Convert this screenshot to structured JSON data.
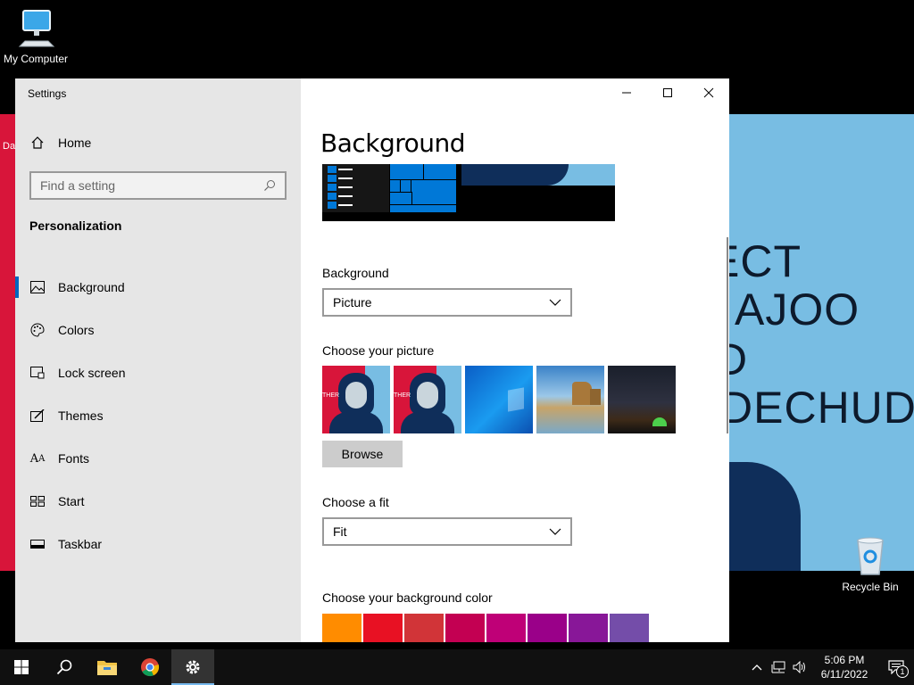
{
  "desktop": {
    "my_computer_label": "My Computer",
    "recycle_bin_label": "Recycle Bin",
    "left_strip_text": "Da",
    "wallpaper_text_lines": [
      "ECT",
      "AJOO",
      "D",
      "DECHUD"
    ]
  },
  "window": {
    "title": "Settings",
    "minimize_icon": "minimize-icon",
    "maximize_icon": "maximize-icon",
    "close_icon": "close-icon"
  },
  "sidebar": {
    "home_label": "Home",
    "search_placeholder": "Find a setting",
    "section_heading": "Personalization",
    "items": [
      {
        "label": "Background",
        "icon": "picture-icon",
        "active": true
      },
      {
        "label": "Colors",
        "icon": "palette-icon",
        "active": false
      },
      {
        "label": "Lock screen",
        "icon": "lock-screen-icon",
        "active": false
      },
      {
        "label": "Themes",
        "icon": "themes-icon",
        "active": false
      },
      {
        "label": "Fonts",
        "icon": "fonts-icon",
        "active": false
      },
      {
        "label": "Start",
        "icon": "start-icon",
        "active": false
      },
      {
        "label": "Taskbar",
        "icon": "taskbar-icon",
        "active": false
      }
    ]
  },
  "main": {
    "page_title": "Background",
    "background_label": "Background",
    "background_value": "Picture",
    "choose_picture_label": "Choose your picture",
    "browse_label": "Browse",
    "choose_fit_label": "Choose a fit",
    "fit_value": "Fit",
    "choose_color_label": "Choose your background color",
    "thumbnails": [
      "portrait-wallpaper-1",
      "portrait-wallpaper-2",
      "windows-default-wallpaper",
      "beach-rocks-wallpaper",
      "night-sky-tent-wallpaper"
    ],
    "thumbnail_text": "THER",
    "colors": [
      "#ff8c00",
      "#e81123",
      "#d13438",
      "#c30052",
      "#bf0077",
      "#9a0089",
      "#881798",
      "#744da9"
    ]
  },
  "taskbar": {
    "items": [
      "start-button",
      "search-button",
      "file-explorer",
      "chrome",
      "settings"
    ],
    "time": "5:06 PM",
    "date": "6/11/2022",
    "notification_count": "1"
  }
}
